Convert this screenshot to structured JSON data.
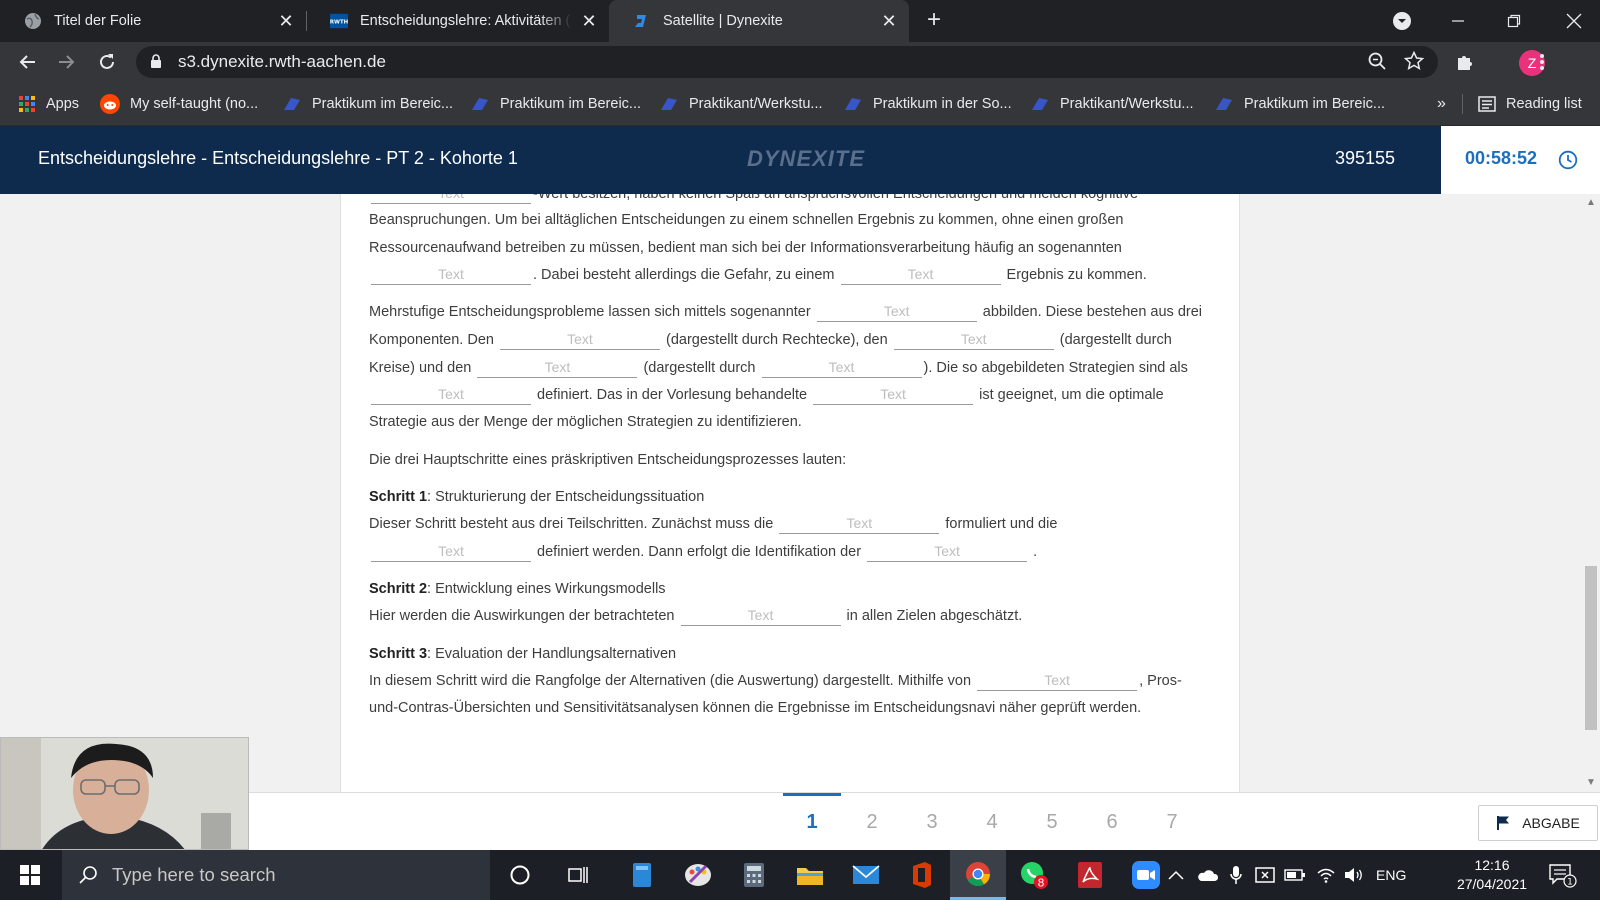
{
  "browser": {
    "tabs": [
      {
        "title": "Titel der Folie",
        "favicon": "globe-icon"
      },
      {
        "title": "Entscheidungslehre: Aktivitäten (",
        "favicon": "rwth-icon"
      },
      {
        "title": "Satellite | Dynexite",
        "favicon": "dynexite-icon",
        "active": true
      }
    ],
    "url": "s3.dynexite.rwth-aachen.de",
    "profile_initial": "Z",
    "bookmarks": [
      {
        "label": "Apps",
        "icon": "apps-grid-icon"
      },
      {
        "label": "My self-taught (no...",
        "icon": "reddit-icon"
      },
      {
        "label": "Praktikum im Bereic...",
        "icon": "bookmark-site-icon"
      },
      {
        "label": "Praktikum im Bereic...",
        "icon": "bookmark-site-icon"
      },
      {
        "label": "Praktikant/Werkstu...",
        "icon": "bookmark-site-icon"
      },
      {
        "label": "Praktikum in der So...",
        "icon": "bookmark-site-icon"
      },
      {
        "label": "Praktikant/Werkstu...",
        "icon": "bookmark-site-icon"
      },
      {
        "label": "Praktikum im Bereic...",
        "icon": "bookmark-site-icon"
      }
    ],
    "overflow": "»",
    "reading_list": "Reading list"
  },
  "app": {
    "title": "Entscheidungslehre - Entscheidungslehre - PT 2 - Kohorte 1",
    "logo": "DYNEXITE",
    "candidate_id": "395155",
    "timer": "00:58:52"
  },
  "field_placeholder": "Text",
  "content": {
    "p1": {
      "l1b": "-Wert besitzen, haben keinen Spaß an anspruchsvollen Entscheidungen und meiden kognitive",
      "l2": "Beanspruchungen. Um bei alltäglichen Entscheidungen zu einem schnellen Ergebnis zu kommen, ohne einen großen",
      "l3": "Ressourcenaufwand betreiben zu müssen, bedient man sich bei der Informationsverarbeitung häufig an sogenannten",
      "l4a": ". Dabei besteht allerdings die Gefahr, zu einem",
      "l4b": "Ergebnis zu kommen."
    },
    "p2": {
      "l1a": "Mehrstufige Entscheidungsprobleme lassen sich mittels sogenannter",
      "l1b": "abbilden. Diese bestehen aus drei",
      "l2a": "Komponenten. Den",
      "l2b": "(dargestellt durch Rechtecke), den",
      "l2c": "(dargestellt durch",
      "l3a": "Kreise) und den",
      "l3b": "(dargestellt durch",
      "l3c": "). Die so abgebildeten Strategien sind als",
      "l4a": "definiert. Das in der Vorlesung behandelte",
      "l4b": "ist geeignet, um die optimale",
      "l5": "Strategie aus der Menge der möglichen Strategien zu identifizieren."
    },
    "p3": "Die drei Hauptschritte eines präskriptiven Entscheidungsprozesses lauten:",
    "s1": {
      "label": "Schritt 1",
      "heading": ": Strukturierung der Entscheidungssituation",
      "l1a": "Dieser Schritt besteht aus drei Teilschritten. Zunächst muss die",
      "l1b": "formuliert und die",
      "l2a": "definiert werden. Dann erfolgt die Identifikation der",
      "l2b": "."
    },
    "s2": {
      "label": "Schritt 2",
      "heading": ": Entwicklung eines Wirkungsmodells",
      "l1a": "Hier werden die Auswirkungen der betrachteten",
      "l1b": "in allen Zielen abgeschätzt."
    },
    "s3": {
      "label": "Schritt 3",
      "heading": ": Evaluation der Handlungsalternativen",
      "l1a": "In diesem Schritt wird die Rangfolge der Alternativen (die Auswertung) dargestellt. Mithilfe von",
      "l1b": ", Pros-",
      "l2": "und-Contras-Übersichten und Sensitivitätsanalysen können die Ergebnisse im Entscheidungsnavi näher geprüft werden."
    }
  },
  "pagination": {
    "pages": [
      "1",
      "2",
      "3",
      "4",
      "5",
      "6",
      "7"
    ],
    "active": "1"
  },
  "submit_label": "ABGABE",
  "taskbar": {
    "search_placeholder": "Type here to search",
    "whatsapp_badge": "8",
    "language": "ENG",
    "time": "12:16",
    "date": "27/04/2021",
    "notification_count": "1"
  },
  "colors": {
    "header": "#0e2b4e",
    "accent": "#1c6fbe"
  }
}
